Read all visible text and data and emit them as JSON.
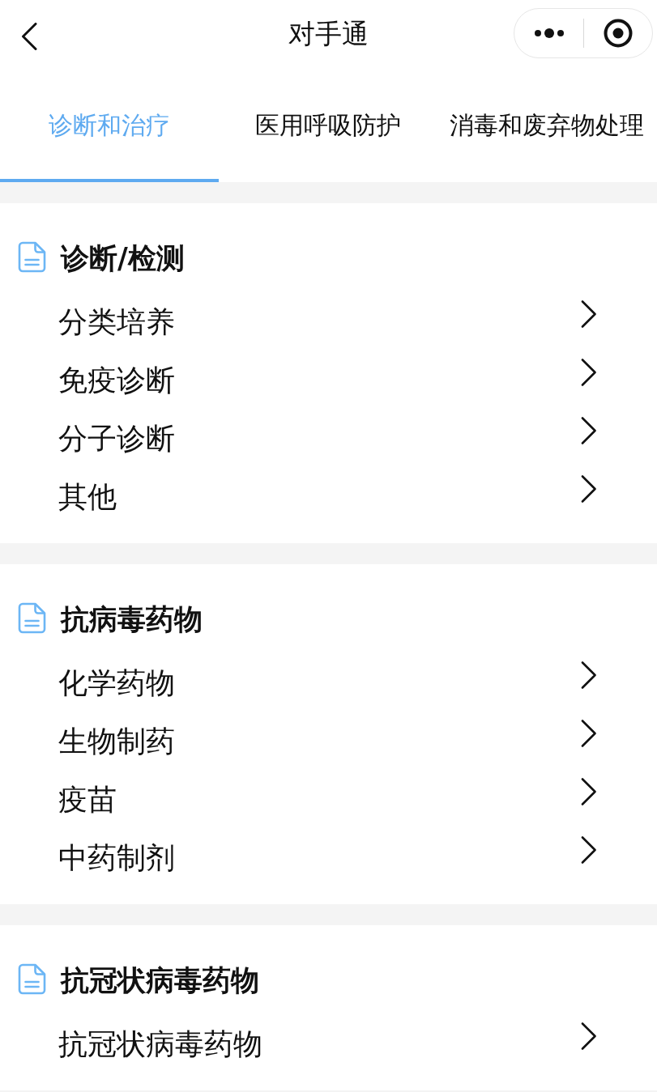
{
  "nav_bar": {
    "title": "对手通"
  },
  "tabs": [
    {
      "label": "诊断和治疗",
      "selected": true
    },
    {
      "label": "医用呼吸防护",
      "selected": false
    },
    {
      "label": "消毒和废弃物处理",
      "selected": false
    }
  ],
  "sections": [
    {
      "title": "诊断/检测",
      "items": [
        {
          "label": "分类培养"
        },
        {
          "label": "免疫诊断"
        },
        {
          "label": "分子诊断"
        },
        {
          "label": "其他"
        }
      ]
    },
    {
      "title": "抗病毒药物",
      "items": [
        {
          "label": "化学药物"
        },
        {
          "label": "生物制药"
        },
        {
          "label": "疫苗"
        },
        {
          "label": "中药制剂"
        }
      ]
    },
    {
      "title": "抗冠状病毒药物",
      "items": [
        {
          "label": "抗冠状病毒药物"
        }
      ]
    }
  ]
}
